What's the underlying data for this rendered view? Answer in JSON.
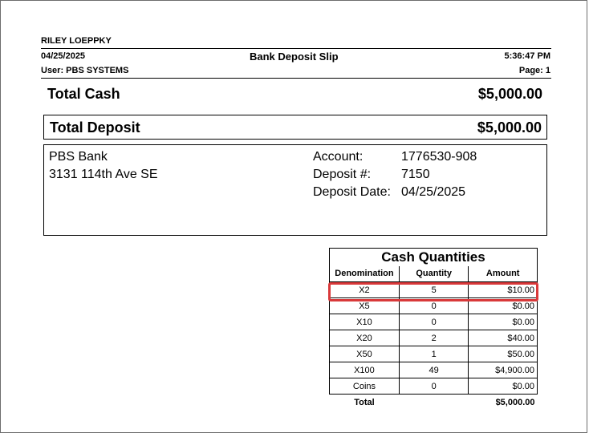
{
  "header": {
    "name": "RILEY LOEPPKY",
    "date": "04/25/2025",
    "title": "Bank Deposit Slip",
    "time": "5:36:47 PM",
    "user": "User: PBS SYSTEMS",
    "page": "Page: 1"
  },
  "totals": {
    "cash_label": "Total Cash",
    "cash_value": "$5,000.00",
    "deposit_label": "Total Deposit",
    "deposit_value": "$5,000.00"
  },
  "bank": {
    "name": "PBS Bank",
    "address": "3131 114th Ave SE",
    "account_label": "Account:",
    "account_value": "1776530-908",
    "deposit_no_label": "Deposit #:",
    "deposit_no_value": "7150",
    "deposit_date_label": "Deposit Date:",
    "deposit_date_value": "04/25/2025"
  },
  "cash_quantities": {
    "title": "Cash Quantities",
    "columns": [
      "Denomination",
      "Quantity",
      "Amount"
    ],
    "rows": [
      {
        "denomination": "X2",
        "quantity": "5",
        "amount": "$10.00"
      },
      {
        "denomination": "X5",
        "quantity": "0",
        "amount": "$0.00"
      },
      {
        "denomination": "X10",
        "quantity": "0",
        "amount": "$0.00"
      },
      {
        "denomination": "X20",
        "quantity": "2",
        "amount": "$40.00"
      },
      {
        "denomination": "X50",
        "quantity": "1",
        "amount": "$50.00"
      },
      {
        "denomination": "X100",
        "quantity": "49",
        "amount": "$4,900.00"
      },
      {
        "denomination": "Coins",
        "quantity": "0",
        "amount": "$0.00"
      }
    ],
    "total_label": "Total",
    "total_value": "$5,000.00"
  },
  "colors": {
    "highlight": "#d9393a"
  }
}
